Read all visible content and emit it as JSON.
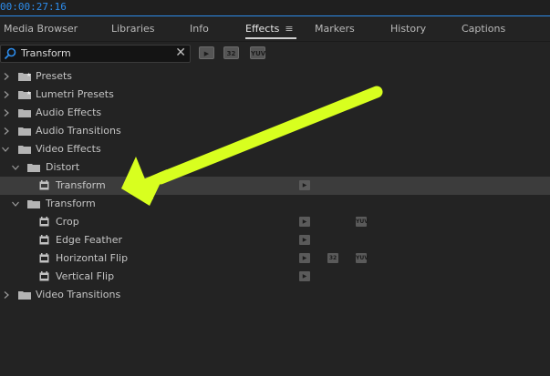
{
  "timecode": "00:00:27:16",
  "tabs": [
    {
      "label": "Media Browser"
    },
    {
      "label": "Libraries"
    },
    {
      "label": "Info"
    },
    {
      "label": "Effects",
      "menu_glyph": "≡"
    },
    {
      "label": "Markers"
    },
    {
      "label": "History"
    },
    {
      "label": "Captions"
    }
  ],
  "search": {
    "value": "Transform",
    "placeholder": ""
  },
  "filters": {
    "accelerated": "▶",
    "bit32": "32",
    "yuv": "YUV"
  },
  "tree": {
    "presets": "Presets",
    "lumetri_presets": "Lumetri Presets",
    "audio_effects": "Audio Effects",
    "audio_transitions": "Audio Transitions",
    "video_effects": "Video Effects",
    "distort": "Distort",
    "distort_transform": "Transform",
    "transform_folder": "Transform",
    "crop": "Crop",
    "edge_feather": "Edge Feather",
    "horizontal_flip": "Horizontal Flip",
    "vertical_flip": "Vertical Flip",
    "video_transitions": "Video Transitions"
  },
  "badges": {
    "accelerated": "▶",
    "bit32": "32",
    "yuv": "YUV"
  },
  "colors": {
    "accent": "#2d8ceb",
    "annotation_arrow": "#d8ff1f"
  }
}
